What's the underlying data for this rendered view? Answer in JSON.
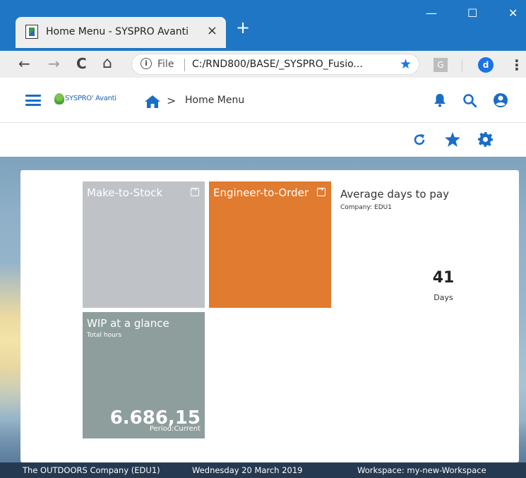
{
  "browser": {
    "tab_title": "Home Menu - SYSPRO Avanti",
    "tab_close": "×",
    "new_tab": "+",
    "window_controls": {
      "minimize": "—",
      "maximize": "☐",
      "close": "✕"
    },
    "nav": {
      "back": "←",
      "forward": "→",
      "reload": "C",
      "home": "⌂"
    },
    "omnibox": {
      "info": "i",
      "scheme_label": "File",
      "url": "C:/RND800/BASE/_SYSPRO_Fusio..."
    },
    "extension_label": "G",
    "profile_initial": "d",
    "menu": "⋮"
  },
  "app": {
    "logo_text": "SYSPRO' Avanti",
    "breadcrumb": {
      "chevron": ">",
      "current": "Home Menu"
    },
    "header_icons": [
      "bell-icon",
      "search-icon",
      "account-icon"
    ],
    "toolbar_icons": [
      "refresh-icon",
      "star-icon",
      "gear-icon"
    ],
    "accent_color": "#1a6cc8"
  },
  "tiles": {
    "make_to_stock": {
      "title": "Make-to-Stock",
      "color": "#bfc3c7"
    },
    "engineer_to_order": {
      "title": "Engineer-to-Order",
      "color": "#e07b2f"
    },
    "average_days_to_pay": {
      "title": "Average days to pay",
      "subtitle": "Company: EDU1",
      "value": "41",
      "unit": "Days"
    },
    "wip": {
      "title": "WIP at a glance",
      "subtitle": "Total hours",
      "value": "6.686,15",
      "period": "Period:Current",
      "color": "#8e9e9d"
    }
  },
  "status": {
    "company": "The OUTDOORS Company (EDU1)",
    "date": "Wednesday 20  March 2019",
    "workspace": "Workspace: my-new-Workspace"
  }
}
